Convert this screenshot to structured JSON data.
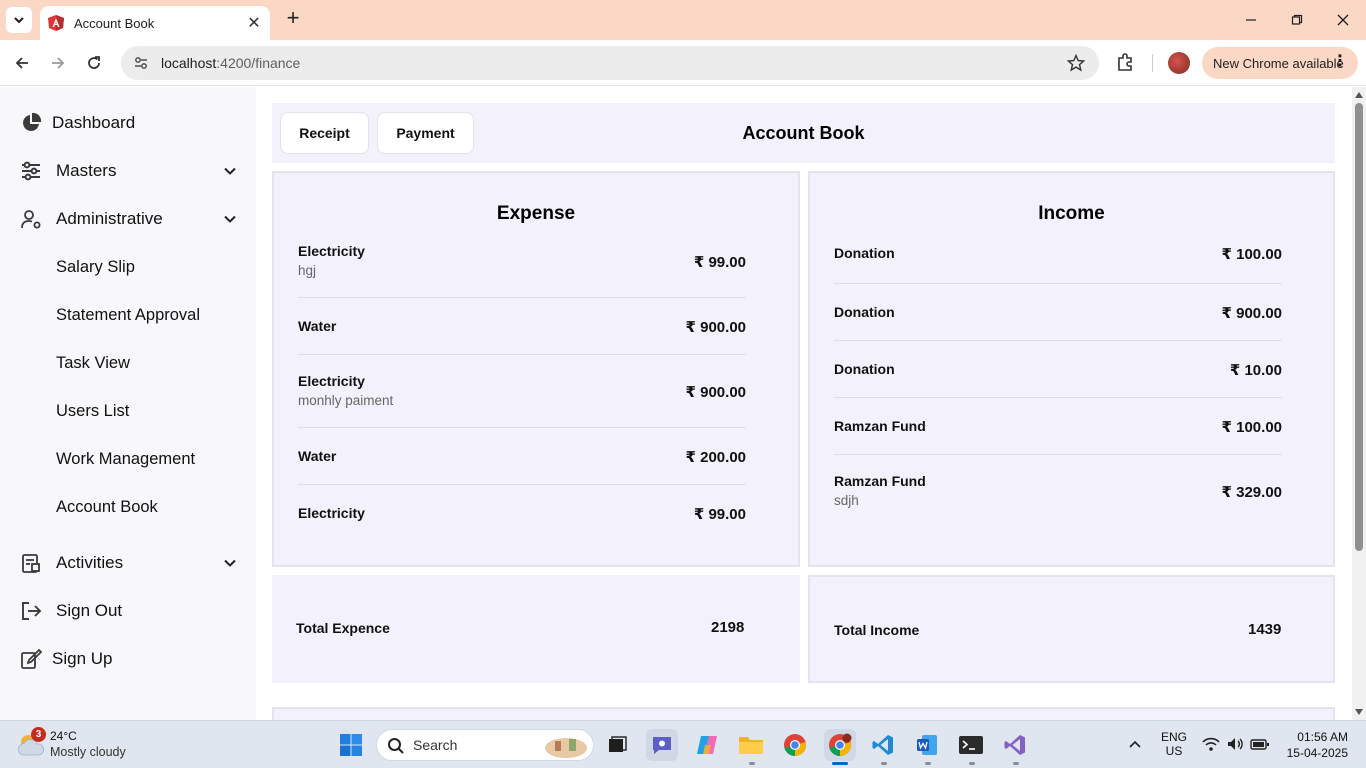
{
  "browser": {
    "tab_title": "Account Book",
    "url_host": "localhost",
    "url_path": ":4200/finance",
    "update_label": "New Chrome available"
  },
  "sidebar": {
    "items": [
      {
        "label": "Dashboard",
        "icon": "pie-chart-icon"
      },
      {
        "label": "Masters",
        "icon": "sliders-icon"
      },
      {
        "label": "Administrative",
        "icon": "user-gear-icon"
      },
      {
        "label": "Activities",
        "icon": "activity-icon"
      },
      {
        "label": "Sign Out",
        "icon": "sign-out-icon"
      },
      {
        "label": "Sign Up",
        "icon": "sign-up-icon"
      }
    ],
    "sub_items": [
      "Salary Slip",
      "Statement Approval",
      "Task View",
      "Users List",
      "Work Management",
      "Account Book"
    ]
  },
  "header": {
    "receipt_label": "Receipt",
    "payment_label": "Payment",
    "title": "Account Book"
  },
  "expense": {
    "title": "Expense",
    "rows": [
      {
        "name": "Electricity",
        "note": "hgj",
        "amount": "₹ 99.00"
      },
      {
        "name": "Water",
        "note": "",
        "amount": "₹ 900.00"
      },
      {
        "name": "Electricity",
        "note": "monhly paiment",
        "amount": "₹ 900.00"
      },
      {
        "name": "Water",
        "note": "",
        "amount": "₹ 200.00"
      },
      {
        "name": "Electricity",
        "note": "",
        "amount": "₹ 99.00"
      }
    ],
    "total_label": "Total Expence",
    "total_value": "2198"
  },
  "income": {
    "title": "Income",
    "rows": [
      {
        "name": "Donation",
        "note": "",
        "amount": "₹ 100.00"
      },
      {
        "name": "Donation",
        "note": "",
        "amount": "₹ 900.00"
      },
      {
        "name": "Donation",
        "note": "",
        "amount": "₹ 10.00"
      },
      {
        "name": "Ramzan Fund",
        "note": "",
        "amount": "₹ 100.00"
      },
      {
        "name": "Ramzan Fund",
        "note": "sdjh",
        "amount": "₹ 329.00"
      }
    ],
    "total_label": "Total Income",
    "total_value": "1439"
  },
  "taskbar": {
    "weather_badge": "3",
    "weather_temp": "24°C",
    "weather_desc": "Mostly cloudy",
    "search_placeholder": "Search",
    "lang_top": "ENG",
    "lang_bottom": "US",
    "time": "01:56 AM",
    "date": "15-04-2025"
  },
  "colors": {
    "tab_strip": "#fbd8c5",
    "panel_bg": "#f3f2fc",
    "sidebar_bg": "#f8f8fb",
    "taskbar_bg": "#dfe6ef",
    "accent_blue": "#0067c0"
  }
}
